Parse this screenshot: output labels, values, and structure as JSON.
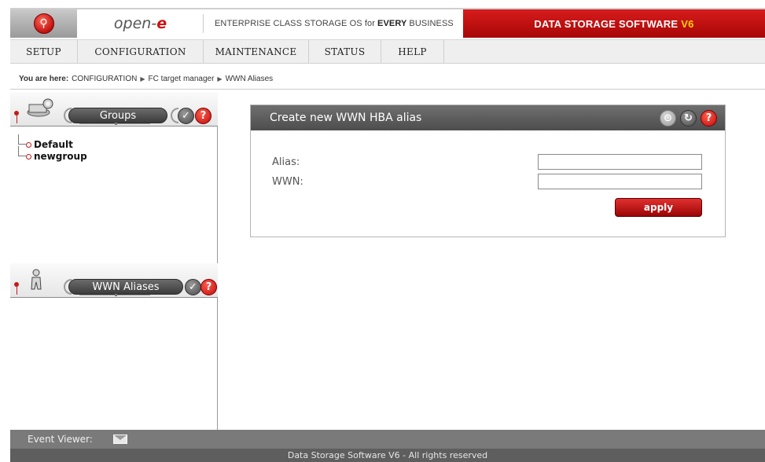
{
  "banner": {
    "brand_prefix": "open-",
    "brand_suffix": "e",
    "tagline_pre": "ENTERPRISE CLASS STORAGE OS for",
    "tagline_bold": "EVERY",
    "tagline_post": "BUSINESS",
    "product": "DATA STORAGE SOFTWARE",
    "product_version": "V6"
  },
  "menu": {
    "items": [
      {
        "label": "SETUP"
      },
      {
        "label": "CONFIGURATION"
      },
      {
        "label": "MAINTENANCE"
      },
      {
        "label": "STATUS"
      },
      {
        "label": "HELP"
      }
    ]
  },
  "breadcrumb": {
    "label": "You are here:",
    "items": [
      "CONFIGURATION",
      "FC target manager",
      "WWN Aliases"
    ]
  },
  "groups_panel": {
    "title": "Groups",
    "items": [
      "Default",
      "newgroup"
    ]
  },
  "aliases_panel": {
    "title": "WWN Aliases"
  },
  "form": {
    "title": "Create new WWN HBA alias",
    "alias_label": "Alias:",
    "alias_value": "",
    "wwn_label": "WWN:",
    "wwn_value": "",
    "apply_label": "apply"
  },
  "event_viewer": {
    "label": "Event Viewer:"
  },
  "footer": {
    "text": "Data Storage Software V6 - All rights reserved"
  },
  "colors": {
    "accent_red": "#c10d0d",
    "header_gray": "#5a5a5a",
    "version_yellow": "#ffd200"
  }
}
